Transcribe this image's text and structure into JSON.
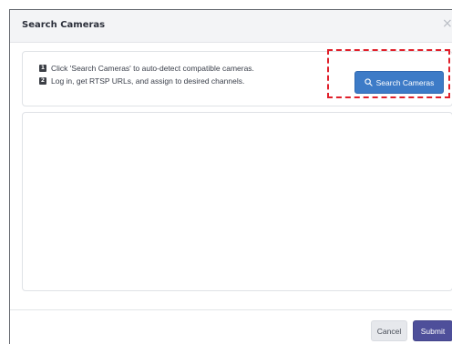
{
  "dialog": {
    "title": "Search Cameras",
    "close_glyph": "×"
  },
  "instructions": {
    "steps": [
      {
        "badge": "1",
        "text": "Click 'Search Cameras' to auto-detect compatible cameras."
      },
      {
        "badge": "2",
        "text": "Log in, get RTSP URLs, and assign to desired channels."
      }
    ]
  },
  "search_button": {
    "label": "Search Cameras",
    "icon": "search-icon"
  },
  "footer": {
    "cancel_label": "Cancel",
    "submit_label": "Submit"
  },
  "colors": {
    "search_button_bg": "#3d7bc7",
    "submit_button_bg": "#4e4f9a",
    "highlight_border": "#e0202b",
    "header_bg": "#f3f4f6"
  }
}
